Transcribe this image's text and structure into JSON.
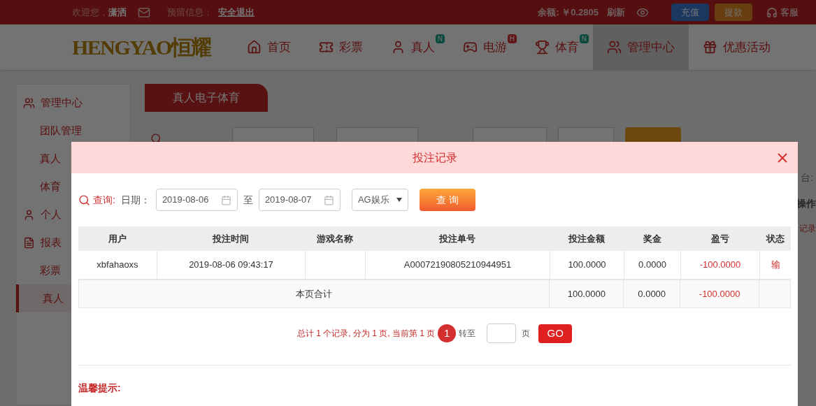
{
  "top_bar": {
    "greeting": "欢迎您，",
    "username": "潇洒",
    "reserved_label": "预留信息：",
    "logout": "安全退出",
    "balance": "余额: ￥0.2805",
    "refresh": "刷新",
    "deposit": "充值",
    "withdraw": "提款",
    "service": "客服"
  },
  "nav": {
    "logo": "HENGYAO恒耀",
    "items": [
      {
        "label": "首页",
        "selected": false
      },
      {
        "label": "彩票",
        "selected": false
      },
      {
        "label": "真人",
        "selected": false,
        "badge": {
          "text": "N",
          "kind": "new"
        }
      },
      {
        "label": "电游",
        "selected": false,
        "badge": {
          "text": "H",
          "kind": "hot"
        }
      },
      {
        "label": "体育",
        "selected": false,
        "badge": {
          "text": "N",
          "kind": "new"
        }
      },
      {
        "label": "管理中心",
        "selected": true
      },
      {
        "label": "优惠活动",
        "selected": false
      }
    ]
  },
  "sidebar": [
    {
      "label": "管理中心",
      "children": [
        {
          "label": "团队管理",
          "selected": false
        },
        {
          "label": "真人",
          "selected": false
        },
        {
          "label": "体育",
          "selected": false
        }
      ]
    },
    {
      "label": "个人"
    },
    {
      "label": "报表",
      "children": [
        {
          "label": "彩票",
          "selected": false
        },
        {
          "label": "真人",
          "selected": true
        }
      ]
    }
  ],
  "page": {
    "tab": "真人电子体育",
    "platform_hint": "台:",
    "column_hint": "操作",
    "link_hint": "记录"
  },
  "modal": {
    "title": "投注记录",
    "query": {
      "label": "查询:",
      "date_label": "日期：",
      "from": "2019-08-06",
      "separator": "至",
      "to": "2019-08-07",
      "platform": "AG娱乐",
      "button": "查 询"
    },
    "columns": [
      "用户",
      "投注时间",
      "游戏名称",
      "投注单号",
      "投注金额",
      "奖金",
      "盈亏",
      "状态"
    ],
    "rows": [
      [
        "xbfahaoxs",
        "2019-08-06 09:43:17",
        "",
        "A00072190805210944951",
        "100.0000",
        "0.0000",
        "-100.0000",
        "输"
      ]
    ],
    "summary": {
      "label": "本页合计",
      "amount": "100.0000",
      "bonus": "0.0000",
      "profit": "-100.0000"
    },
    "pagination": {
      "summary": "总计 1 个记录, 分为 1 页, 当前第 1 页",
      "pages": [
        {
          "label": "1",
          "selected": true
        }
      ],
      "goto": "转至",
      "suffix": "页",
      "go": "GO"
    },
    "notice": {
      "title": "温馨提示:"
    }
  }
}
